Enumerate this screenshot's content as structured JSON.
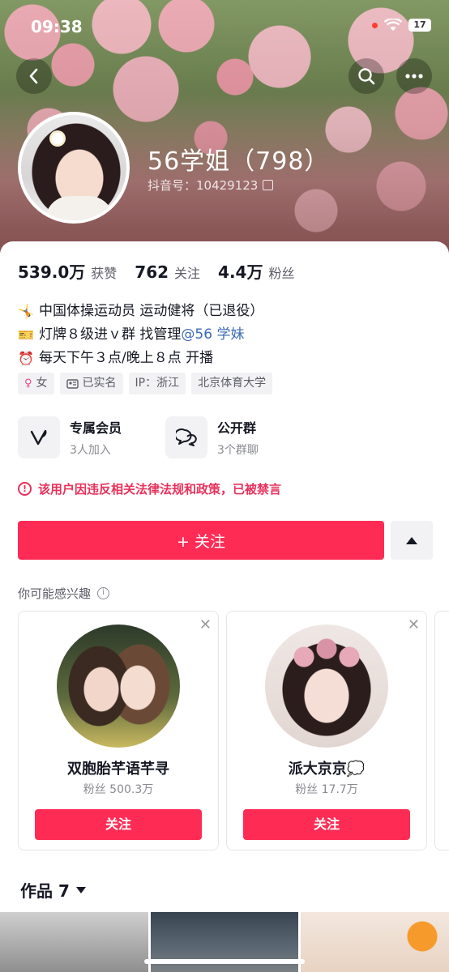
{
  "status_bar": {
    "time": "09:38",
    "battery": "17"
  },
  "profile": {
    "display_name": "56学姐（798）",
    "douyin_id": "抖音号：10429123"
  },
  "stats": [
    {
      "value": "539.0万",
      "label": "获赞"
    },
    {
      "value": "762",
      "label": "关注"
    },
    {
      "value": "4.4万",
      "label": "粉丝"
    }
  ],
  "bio": {
    "line1": "中国体操运动员 运动健将（已退役）",
    "line2_prefix": "灯牌８级进ｖ群 找管理 ",
    "line2_mention": "@56 学妹",
    "line3": "每天下午３点/晚上８点 开播"
  },
  "tags": [
    "女",
    "已实名",
    "IP：浙江",
    "北京体育大学"
  ],
  "services": [
    {
      "title": "专属会员",
      "subtitle": "3人加入"
    },
    {
      "title": "公开群",
      "subtitle": "3个群聊"
    }
  ],
  "banned_notice": "该用户因违反相关法律法规和政策，已被禁言",
  "follow_button": "+ 关注",
  "interest_section": {
    "title": "你可能感兴趣",
    "cards": [
      {
        "name": "双胞胎芊语芊寻",
        "fans": "粉丝 500.3万",
        "button": "关注"
      },
      {
        "name": "派大京京💭",
        "fans": "粉丝 17.7万",
        "button": "关注"
      }
    ]
  },
  "works_tab": {
    "label": "作品 7"
  },
  "icons": {
    "back": "back-arrow-icon",
    "search": "search-icon",
    "more": "more-dots-icon",
    "copy": "copy-icon",
    "vip": "v-icon",
    "group": "chat-bubbles-icon",
    "warning": "exclamation-circle-icon",
    "info": "info-icon",
    "gymnast": "gymnast-emoji",
    "ticket": "ticket-emoji",
    "clock": "alarm-clock-emoji"
  },
  "colors": {
    "accent": "#fe2c55",
    "warning": "#e8315b",
    "mention": "#3a6bb5"
  }
}
